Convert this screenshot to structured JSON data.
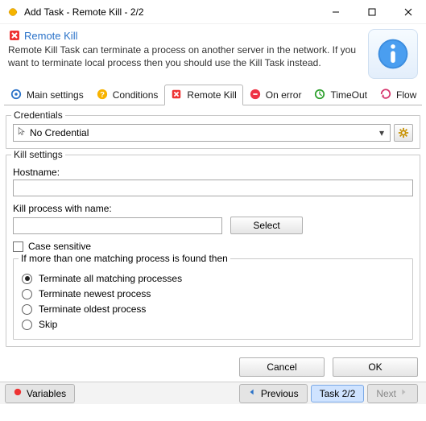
{
  "window": {
    "title": "Add Task - Remote Kill - 2/2"
  },
  "header": {
    "title": "Remote Kill",
    "desc": "Remote Kill Task can terminate a process on another server in the network. If you want to terminate local process then you should use the Kill Task instead."
  },
  "tabs": {
    "main": "Main settings",
    "conditions": "Conditions",
    "remotekill": "Remote Kill",
    "onerror": "On error",
    "timeout": "TimeOut",
    "flow": "Flow"
  },
  "credentials": {
    "legend": "Credentials",
    "value": "No Credential"
  },
  "kill": {
    "legend": "Kill settings",
    "hostname_label": "Hostname:",
    "hostname_value": "",
    "procname_label": "Kill process with name:",
    "procname_value": "",
    "select_btn": "Select",
    "casesensitive": "Case sensitive",
    "subgroup_legend": "If more than one matching process is found then",
    "opt_all": "Terminate all matching processes",
    "opt_newest": "Terminate newest process",
    "opt_oldest": "Terminate oldest process",
    "opt_skip": "Skip"
  },
  "footer": {
    "cancel": "Cancel",
    "ok": "OK"
  },
  "bottom": {
    "variables": "Variables",
    "previous": "Previous",
    "task": "Task 2/2",
    "next": "Next"
  }
}
